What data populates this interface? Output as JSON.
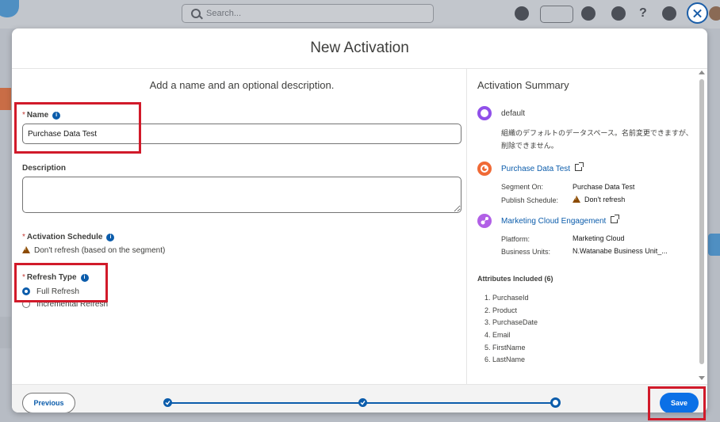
{
  "bg": {
    "search_placeholder": "Search..."
  },
  "modal": {
    "title": "New Activation"
  },
  "form": {
    "subtitle": "Add a name and an optional description.",
    "required_mark": "*",
    "name_label": "Name",
    "name_value": "Purchase Data Test",
    "description_label": "Description",
    "description_value": "",
    "schedule_label": "Activation Schedule",
    "schedule_value": "Don't refresh (based on the segment)",
    "refresh_type_label": "Refresh Type",
    "refresh_options": [
      {
        "label": "Full Refresh",
        "selected": true
      },
      {
        "label": "Incremental Refresh",
        "selected": false
      }
    ]
  },
  "summary": {
    "title": "Activation Summary",
    "dataspace": {
      "name": "default",
      "description_line1": "組織のデフォルトのデータスペース。名前変更できますが、",
      "description_line2": "削除できません。"
    },
    "segment": {
      "name": "Purchase Data Test",
      "segment_on_label": "Segment On:",
      "segment_on_value": "Purchase Data Test",
      "publish_label": "Publish Schedule:",
      "publish_value": "Don't refresh"
    },
    "target": {
      "name": "Marketing Cloud Engagement",
      "platform_label": "Platform:",
      "platform_value": "Marketing Cloud",
      "bu_label": "Business Units:",
      "bu_value": "N.Watanabe Business Unit_..."
    },
    "attributes_title": "Attributes Included (6)",
    "attributes": [
      "1. PurchaseId",
      "2. Product",
      "3. PurchaseDate",
      "4. Email",
      "5. FirstName",
      "6. LastName"
    ]
  },
  "footer": {
    "previous_label": "Previous",
    "save_label": "Save"
  },
  "progress": {
    "completed_steps": 2,
    "total_steps": 3
  },
  "colors": {
    "brand": "#0b5cab",
    "save": "#0b70e6",
    "highlight": "#d11a2a",
    "segment_icon": "#f06a36",
    "dataspace_icon": "#9050e9",
    "target_icon": "#b160e6"
  }
}
